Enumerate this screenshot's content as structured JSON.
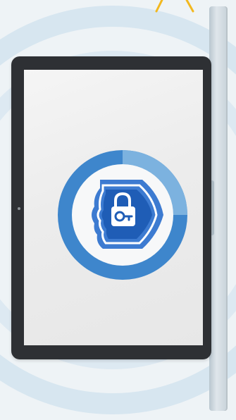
{
  "illustration": {
    "subject": "tablet-with-security-shield",
    "icons": [
      "shield-icon",
      "padlock-icon",
      "key-icon",
      "signal-ripples"
    ],
    "colors": {
      "background": "#eef3f6",
      "ripple": "#d3e3ee",
      "tablet_frame": "#2e3034",
      "screen": "#ececec",
      "ring_primary": "#3e86cc",
      "ring_light": "#7cb2df",
      "shield_dark": "#1f5db6",
      "shield_mid": "#3d7bd1",
      "accent_spark": "#f2b81f"
    }
  }
}
